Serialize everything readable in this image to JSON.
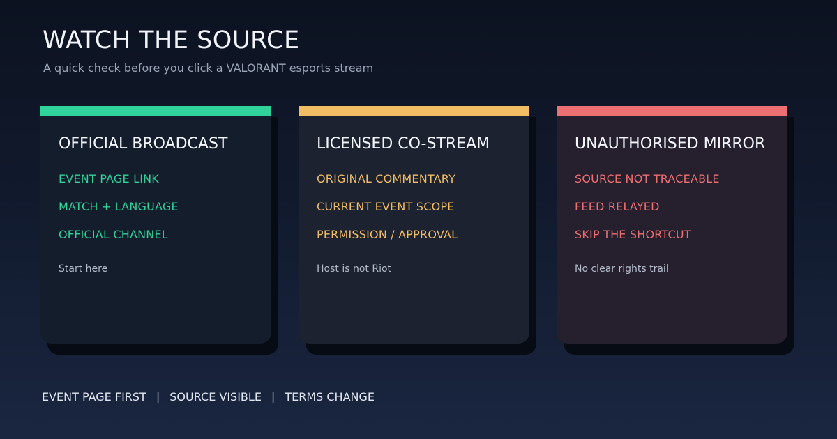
{
  "header": {
    "title": "WATCH THE SOURCE",
    "subtitle": "A quick check before you click a VALORANT esports stream"
  },
  "cards": [
    {
      "title": "OFFICIAL BROADCAST",
      "accent": "#2fd39b",
      "items": [
        "EVENT PAGE LINK",
        "MATCH + LANGUAGE",
        "OFFICIAL CHANNEL"
      ],
      "note": "Start here"
    },
    {
      "title": "LICENSED CO-STREAM",
      "accent": "#f2bd63",
      "items": [
        "ORIGINAL COMMENTARY",
        "CURRENT EVENT SCOPE",
        "PERMISSION / APPROVAL"
      ],
      "note": "Host is not Riot"
    },
    {
      "title": "UNAUTHORISED MIRROR",
      "accent": "#ee6f72",
      "items": [
        "SOURCE NOT TRACEABLE",
        "FEED RELAYED",
        "SKIP THE SHORTCUT"
      ],
      "note": "No clear rights trail"
    }
  ],
  "footer": {
    "items": [
      "EVENT PAGE FIRST",
      "SOURCE VISIBLE",
      "TERMS CHANGE"
    ],
    "separator": "|"
  },
  "colors": {
    "card_bg_official": "#141d2c",
    "card_bg_licensed": "#1c2230",
    "card_bg_mirror": "#261f2e"
  }
}
